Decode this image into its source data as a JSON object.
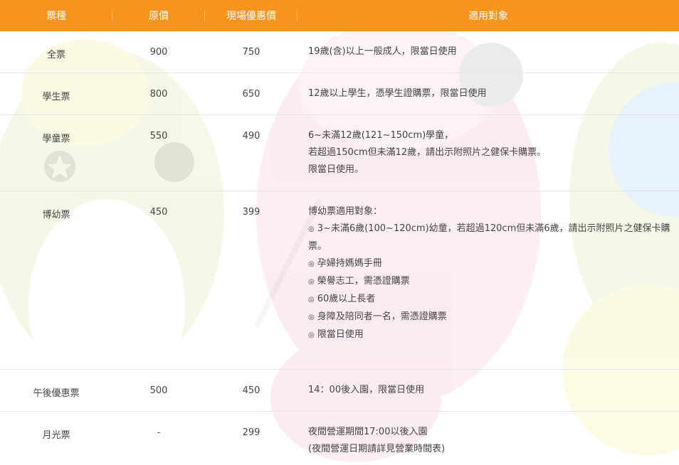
{
  "header": {
    "col_type": "票種",
    "col_original": "原價",
    "col_onsite": "現場優惠價",
    "col_eligible": "適用對象"
  },
  "rows": [
    {
      "type": "全票",
      "original": "900",
      "onsite": "750",
      "lines": [
        "19歲(含)以上一般成人，限當日使用"
      ]
    },
    {
      "type": "學生票",
      "original": "800",
      "onsite": "650",
      "lines": [
        "12歲以上學生，憑學生證購票，限當日使用"
      ]
    },
    {
      "type": "學童票",
      "original": "550",
      "onsite": "490",
      "lines": [
        "6~未滿12歲(121~150cm)學童，",
        "若超過150cm但未滿12歲，請出示附照片之健保卡購票。",
        "限當日使用。"
      ]
    },
    {
      "type": "博幼票",
      "original": "450",
      "onsite": "399",
      "lines": [
        "博幼票適用對象："
      ],
      "bullet_symbol": "◎",
      "bullets": [
        "3~未滿6歲(100~120cm)幼童，若超過120cm但未滿6歲，請出示附照片之健保卡購票。",
        "孕婦持媽媽手冊",
        "榮譽志工，需憑證購票",
        "60歲以上長者",
        "身障及陪同者一名，需憑證購票",
        "限當日使用"
      ]
    },
    {
      "type": "午後優惠票",
      "original": "500",
      "onsite": "450",
      "lines": [
        "14：00後入園，限當日使用"
      ]
    },
    {
      "type": "月光票",
      "original": "-",
      "onsite": "299",
      "lines": [
        "夜間營運期間17:00以後入園",
        "(夜間營運日期請詳見營業時間表)"
      ]
    }
  ],
  "colors": {
    "header_bg": "#f7941d",
    "header_text": "#ffffff",
    "body_text": "#444444",
    "divider": "#e6e6e6"
  }
}
